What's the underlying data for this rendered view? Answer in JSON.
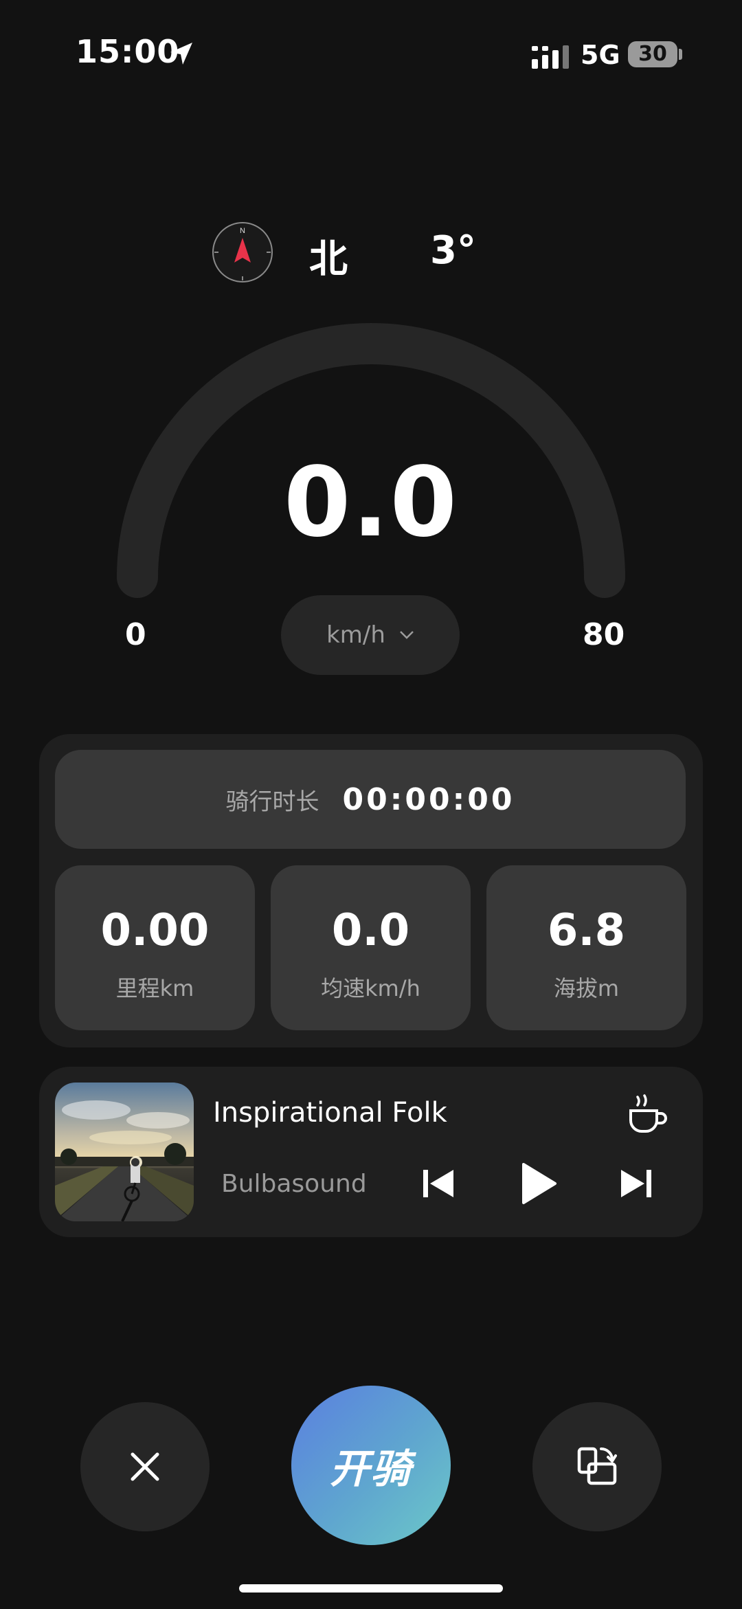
{
  "status": {
    "time": "15:00",
    "network": "5G",
    "battery": "30"
  },
  "heading": {
    "direction": "北",
    "degrees": "3°",
    "compass_letter": "N"
  },
  "speedometer": {
    "speed": "0.0",
    "min_label": "0",
    "max_label": "80",
    "unit": "km/h",
    "level": 0
  },
  "stats": {
    "duration_label": "骑行时长",
    "duration_value": "00:00:00",
    "items": [
      {
        "value": "0.00",
        "label": "里程km"
      },
      {
        "value": "0.0",
        "label": "均速km/h"
      },
      {
        "value": "6.8",
        "label": "海拔m"
      }
    ]
  },
  "music": {
    "title": "Inspirational Folk",
    "artist": "Bulbasound"
  },
  "controls": {
    "start_label": "开骑"
  },
  "colors": {
    "background": "#121212",
    "accent_start": "#5a7fe0",
    "accent_end": "#6cc9c8",
    "compass_needle": "#e8334a"
  }
}
